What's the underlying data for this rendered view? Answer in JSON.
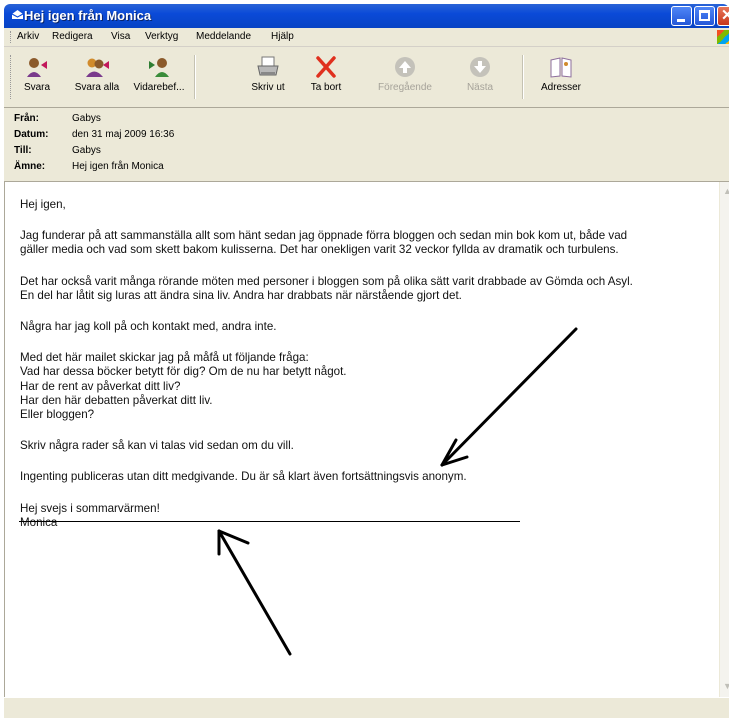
{
  "window": {
    "title": "Hej igen från Monica"
  },
  "menu": {
    "items": [
      "Arkiv",
      "Redigera",
      "Visa",
      "Verktyg",
      "Meddelande",
      "Hjälp"
    ]
  },
  "toolbar": {
    "buttons": [
      {
        "label": "Svara",
        "icon": "reply-icon",
        "enabled": true
      },
      {
        "label": "Svara alla",
        "icon": "reply-all-icon",
        "enabled": true
      },
      {
        "label": "Vidarebef...",
        "icon": "forward-icon",
        "enabled": true
      },
      {
        "label": "Skriv ut",
        "icon": "print-icon",
        "enabled": true
      },
      {
        "label": "Ta bort",
        "icon": "delete-icon",
        "enabled": true
      },
      {
        "label": "Föregående",
        "icon": "previous-icon",
        "enabled": false
      },
      {
        "label": "Nästa",
        "icon": "next-icon",
        "enabled": false
      },
      {
        "label": "Adresser",
        "icon": "address-book-icon",
        "enabled": true
      }
    ]
  },
  "header": {
    "from_label": "Från:",
    "from_value": "Gabys",
    "date_label": "Datum:",
    "date_value": "den 31 maj 2009 16:36",
    "to_label": "Till:",
    "to_value": "Gabys",
    "subject_label": "Ämne:",
    "subject_value": "Hej igen från Monica"
  },
  "message": {
    "paragraphs": [
      "Hej igen,",
      "Jag funderar på att sammanställa allt som hänt sedan jag öppnade förra bloggen och sedan min bok kom ut, både vad\ngäller media och vad som skett bakom kulisserna. Det har onekligen varit 32 veckor fyllda av dramatik och turbulens.",
      "Det har också varit många rörande möten med personer i bloggen som på olika sätt varit drabbade av Gömda och Asyl.\nEn del har låtit sig luras att ändra sina liv. Andra har drabbats när närstående gjort det.",
      "Några har jag koll på och kontakt med, andra inte.",
      "Med det här mailet skickar jag på måfå ut följande fråga:\nVad har dessa böcker betytt för dig?  Om de nu har betytt något.\nHar de rent av påverkat ditt liv?\nHar den här debatten påverkat ditt liv.\nEller bloggen?",
      "Skriv några rader så kan vi talas vid sedan om du vill.",
      "Ingenting publiceras utan ditt medgivande. Du är så klart även fortsättningsvis anonym.",
      "Hej svejs i sommarvärmen!\nMonica"
    ]
  },
  "colors": {
    "titlebar": "#0a4ad8",
    "chrome": "#ece9d8",
    "delete_red": "#e0301e"
  }
}
